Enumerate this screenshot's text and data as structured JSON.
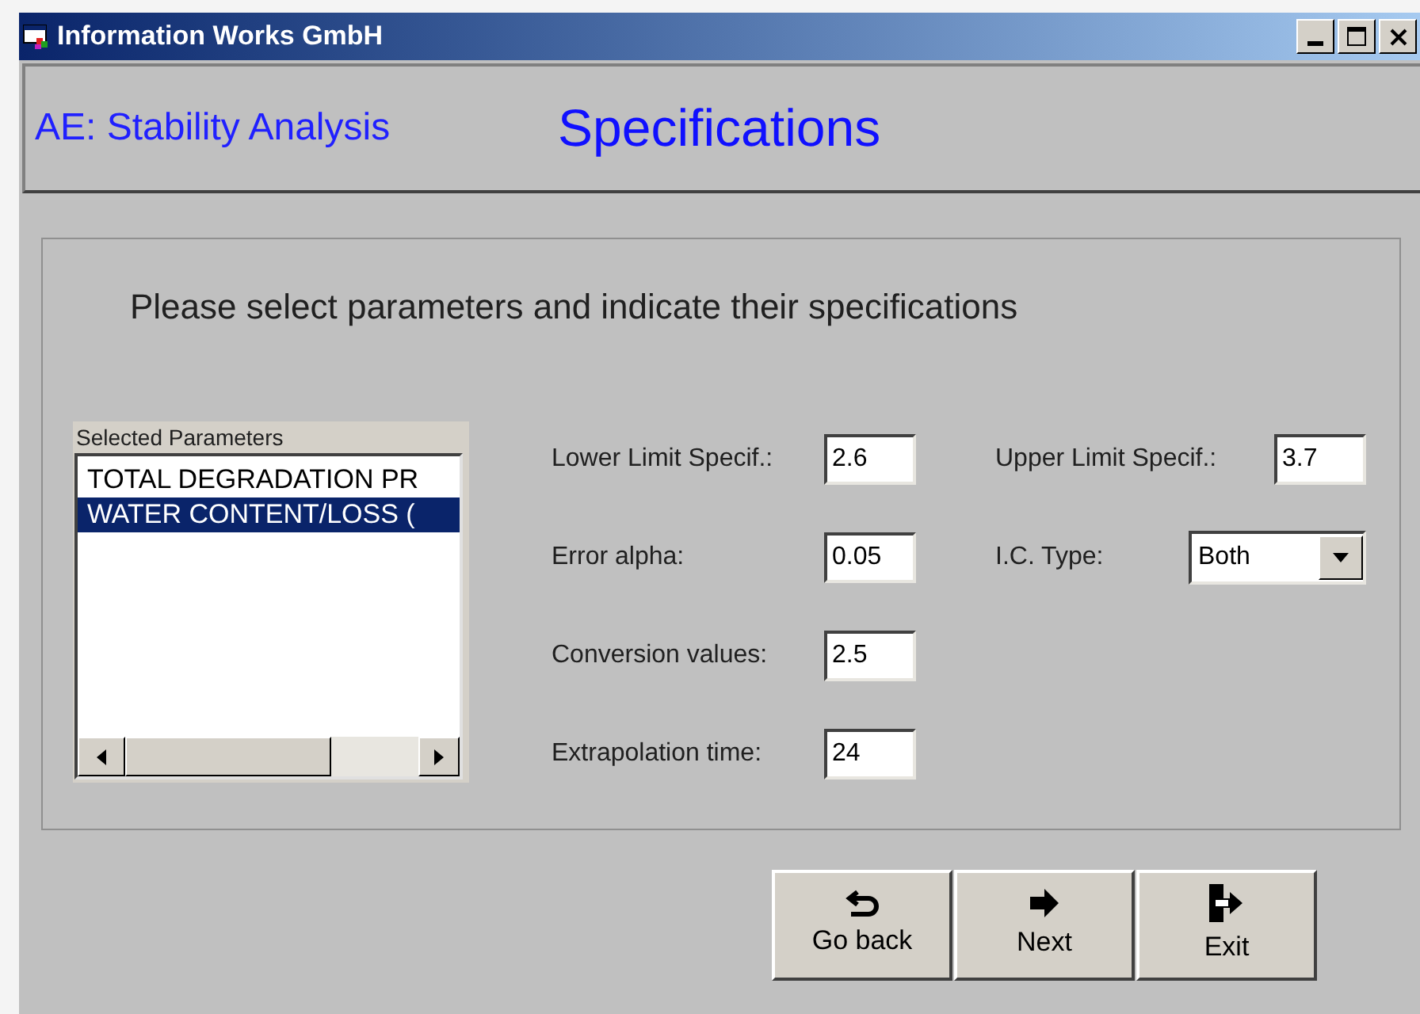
{
  "window": {
    "title": "Information Works GmbH"
  },
  "header": {
    "app_name": "AE: Stability Analysis",
    "page_title": "Specifications"
  },
  "instruction": "Please select parameters and indicate their specifications",
  "parameter_list": {
    "caption": "Selected Parameters",
    "items": [
      {
        "text": "TOTAL DEGRADATION PR",
        "selected": false
      },
      {
        "text": "WATER CONTENT/LOSS (",
        "selected": true
      }
    ]
  },
  "left_fields": [
    {
      "kind": "text",
      "label": "Lower Limit Specif.:",
      "value": "2.6"
    },
    {
      "kind": "text",
      "label": "Error alpha:",
      "value": "0.05"
    },
    {
      "kind": "text",
      "label": "Conversion values:",
      "value": "2.5"
    },
    {
      "kind": "text",
      "label": "Extrapolation time:",
      "value": "24"
    }
  ],
  "right_fields": [
    {
      "kind": "text",
      "label": "Upper Limit Specif.:",
      "value": "3.7"
    },
    {
      "kind": "dropdown",
      "label": "I.C. Type:",
      "value": "Both"
    }
  ],
  "buttons": [
    {
      "kind": "back",
      "label": "Go back"
    },
    {
      "kind": "next",
      "label": "Next"
    },
    {
      "kind": "exit",
      "label": "Exit"
    }
  ]
}
